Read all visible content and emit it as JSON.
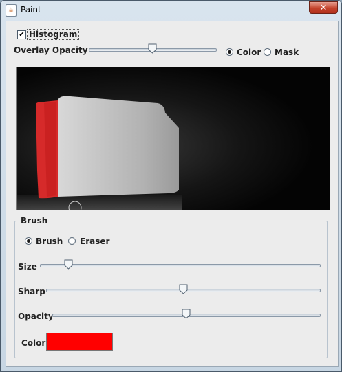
{
  "window": {
    "title": "Paint",
    "close_glyph": "✕"
  },
  "top": {
    "histogram_label": "Histogram",
    "histogram_checked": true,
    "overlay_label": "Overlay Opacity",
    "overlay_value": 0.5,
    "overlay_modes": [
      {
        "label": "Color",
        "selected": true
      },
      {
        "label": "Mask",
        "selected": false
      }
    ]
  },
  "brush": {
    "group_title": "Brush",
    "tools": [
      {
        "label": "Brush",
        "selected": true
      },
      {
        "label": "Eraser",
        "selected": false
      }
    ],
    "size_label": "Size",
    "size_value": 0.1,
    "sharp_label": "Sharp",
    "sharp_value": 0.5,
    "opacity_label": "Opacity",
    "opacity_value": 0.5,
    "color_label": "Color",
    "color_value": "#ff0000"
  },
  "colors": {
    "accent": "#ff0000",
    "canvas_bg": "#030303",
    "titlebar_close": "#c4432b"
  },
  "icons": {
    "app": "java-cup-icon",
    "close": "close-icon",
    "check": "checkmark-icon"
  }
}
